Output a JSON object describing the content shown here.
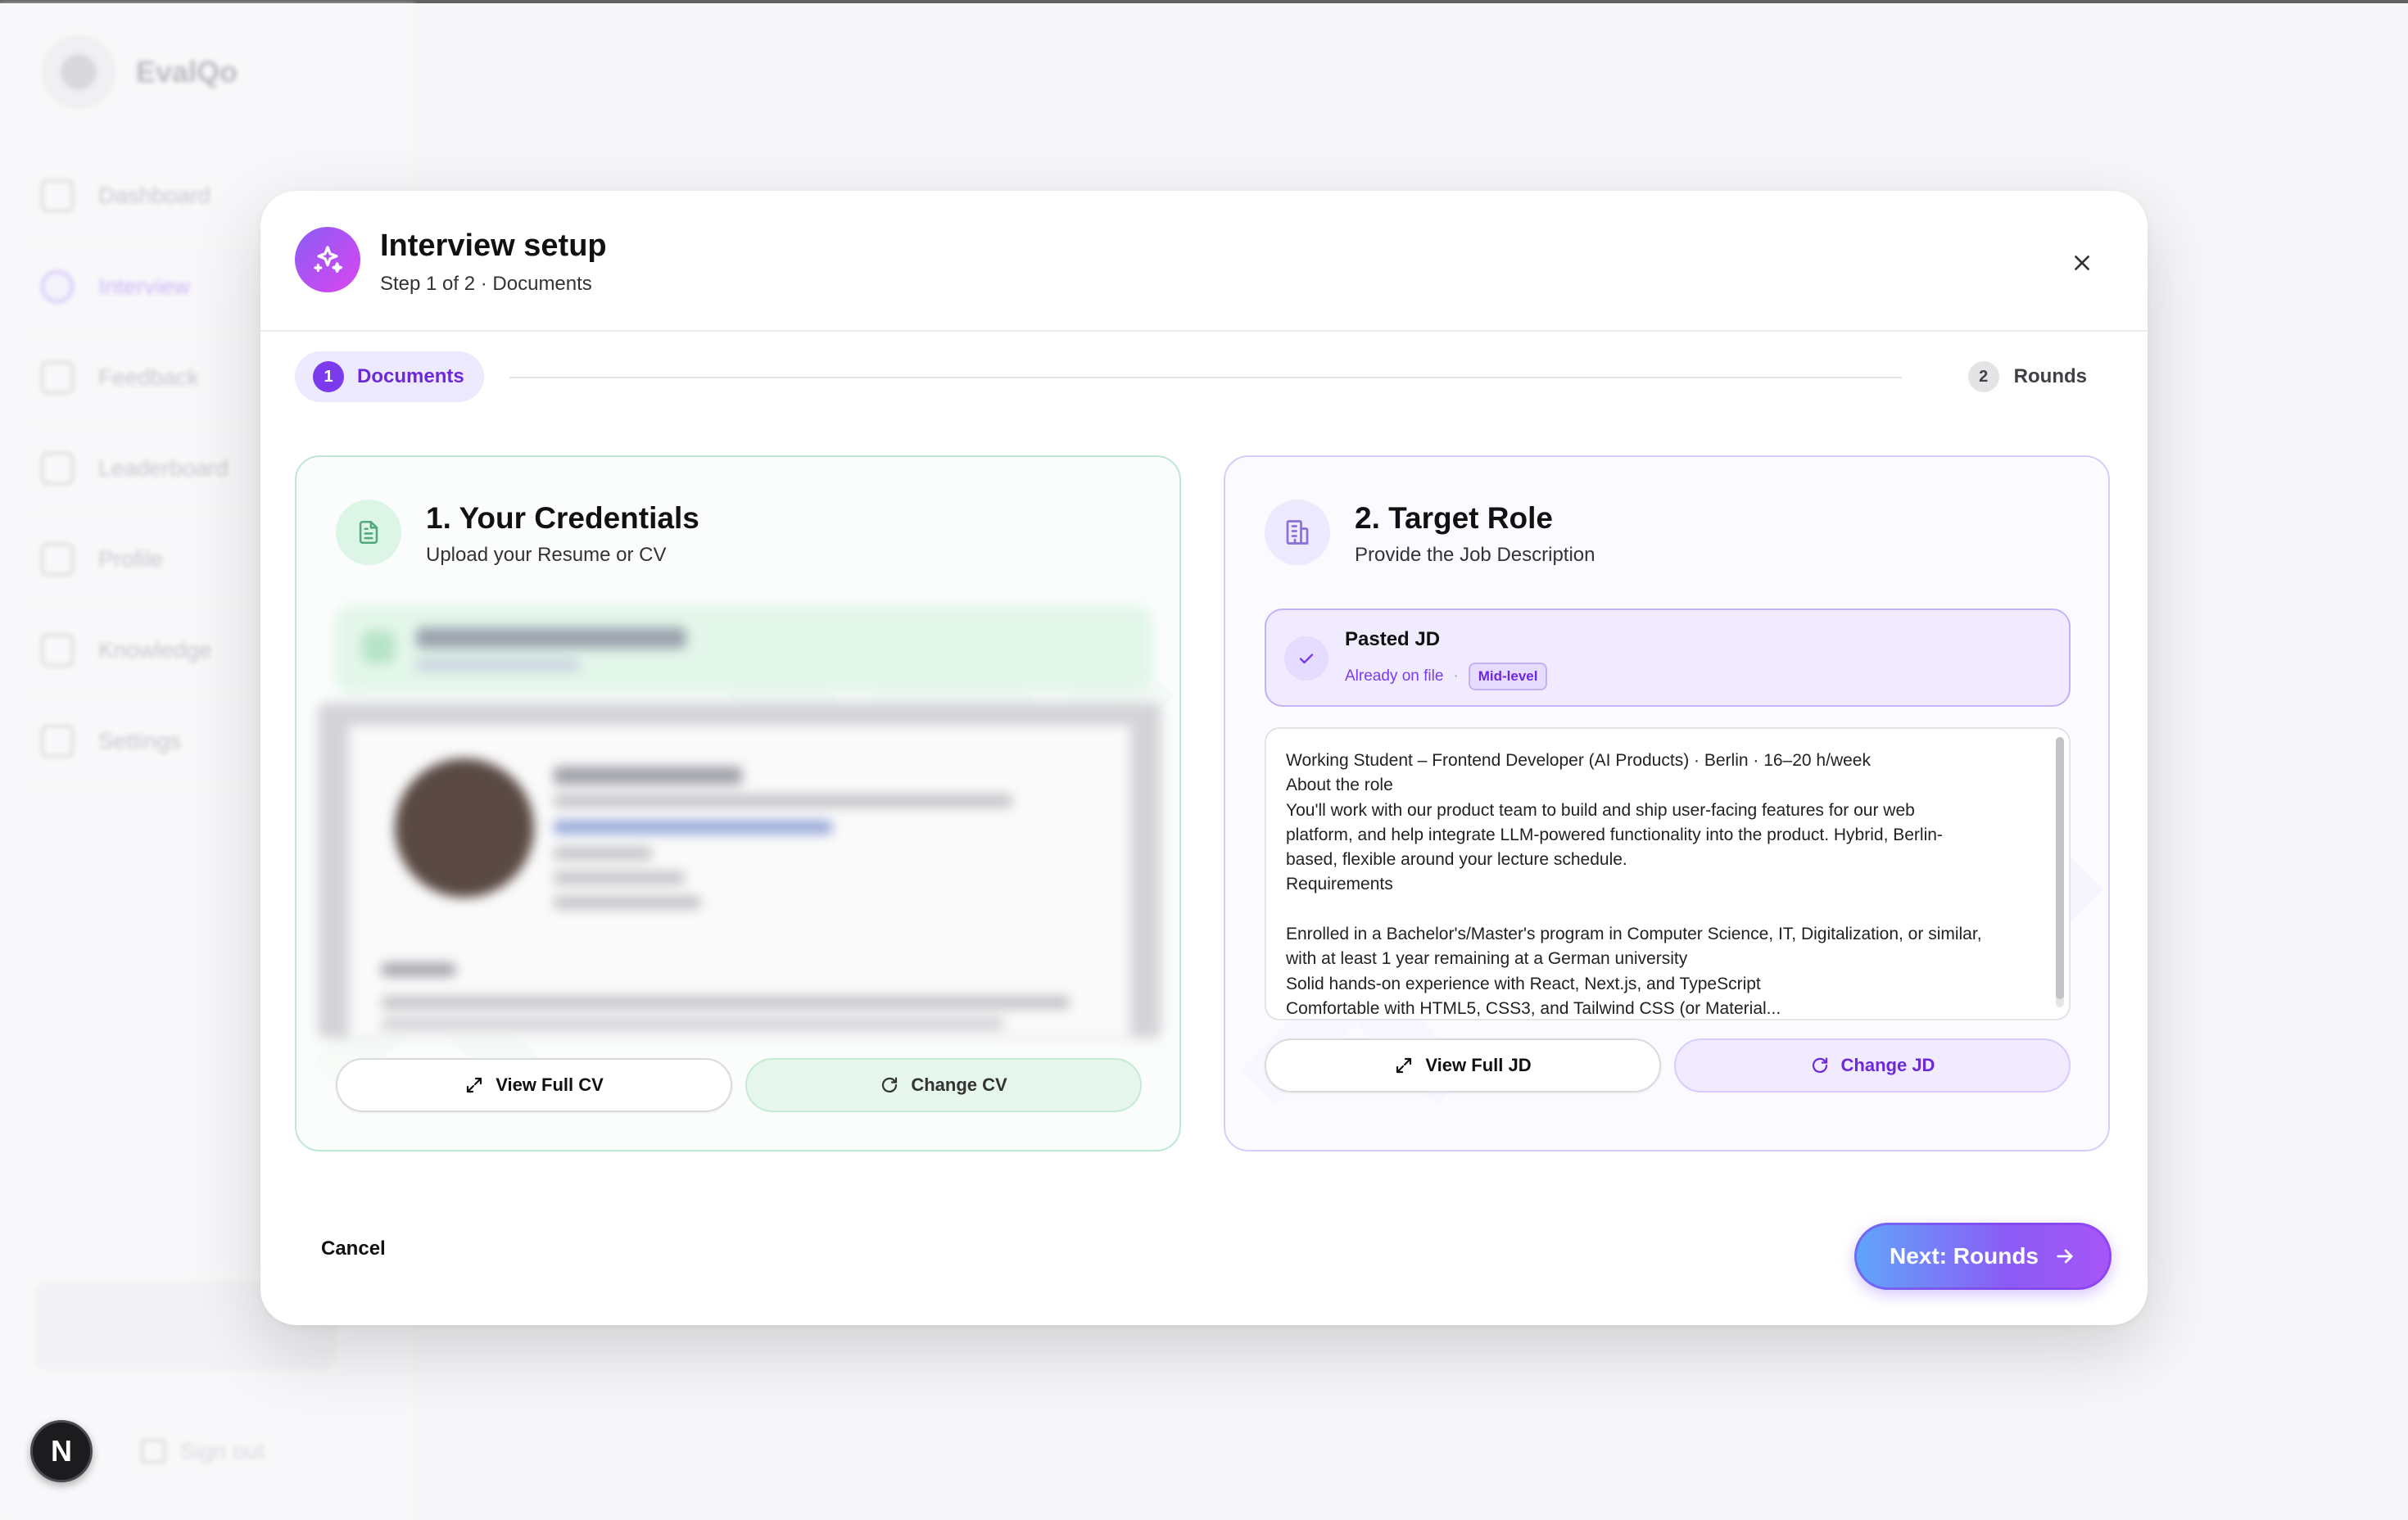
{
  "app": {
    "brand": "EvalQo",
    "nav": [
      {
        "label": "Dashboard",
        "icon": "dashboard-icon"
      },
      {
        "label": "Interview",
        "icon": "interview-icon",
        "active": true
      },
      {
        "label": "Feedback",
        "icon": "feedback-icon"
      },
      {
        "label": "Leaderboard",
        "icon": "trophy-icon"
      },
      {
        "label": "Profile",
        "icon": "user-icon"
      },
      {
        "label": "Knowledge",
        "icon": "book-icon"
      },
      {
        "label": "Settings",
        "icon": "gear-icon"
      }
    ],
    "sign_out": "Sign out",
    "dev_badge": "N"
  },
  "modal": {
    "title": "Interview setup",
    "subtitle": "Step 1 of 2 · Documents",
    "steps": [
      {
        "number": "1",
        "label": "Documents",
        "active": true
      },
      {
        "number": "2",
        "label": "Rounds",
        "active": false
      }
    ],
    "credentials": {
      "title": "1. Your Credentials",
      "subtitle": "Upload your Resume or CV",
      "view_button": "View Full CV",
      "change_button": "Change CV"
    },
    "target_role": {
      "title": "2. Target Role",
      "subtitle": "Provide the Job Description",
      "status_title": "Pasted JD",
      "status_meta": "Already on file",
      "status_sep": "·",
      "level_badge": "Mid-level",
      "jd_lines": [
        "Working Student – Frontend Developer (AI Products) · Berlin · 16–20 h/week",
        "About the role",
        "You'll work with our product team to build and ship user-facing features for our web",
        "platform, and help integrate LLM-powered functionality into the product. Hybrid, Berlin-",
        "based, flexible around your lecture schedule.",
        "Requirements",
        " ",
        "Enrolled in a Bachelor's/Master's program in Computer Science, IT, Digitalization, or similar,",
        "with at least 1 year remaining at a German university",
        "Solid hands-on experience with React, Next.js, and TypeScript",
        "Comfortable with HTML5, CSS3, and Tailwind CSS (or Material..."
      ],
      "view_button": "View Full JD",
      "change_button": "Change JD"
    },
    "cancel": "Cancel",
    "next": "Next: Rounds"
  },
  "colors": {
    "accent": "#7c3aed",
    "credentials_border": "#bfe8d2",
    "role_border": "#d8ccfb"
  }
}
